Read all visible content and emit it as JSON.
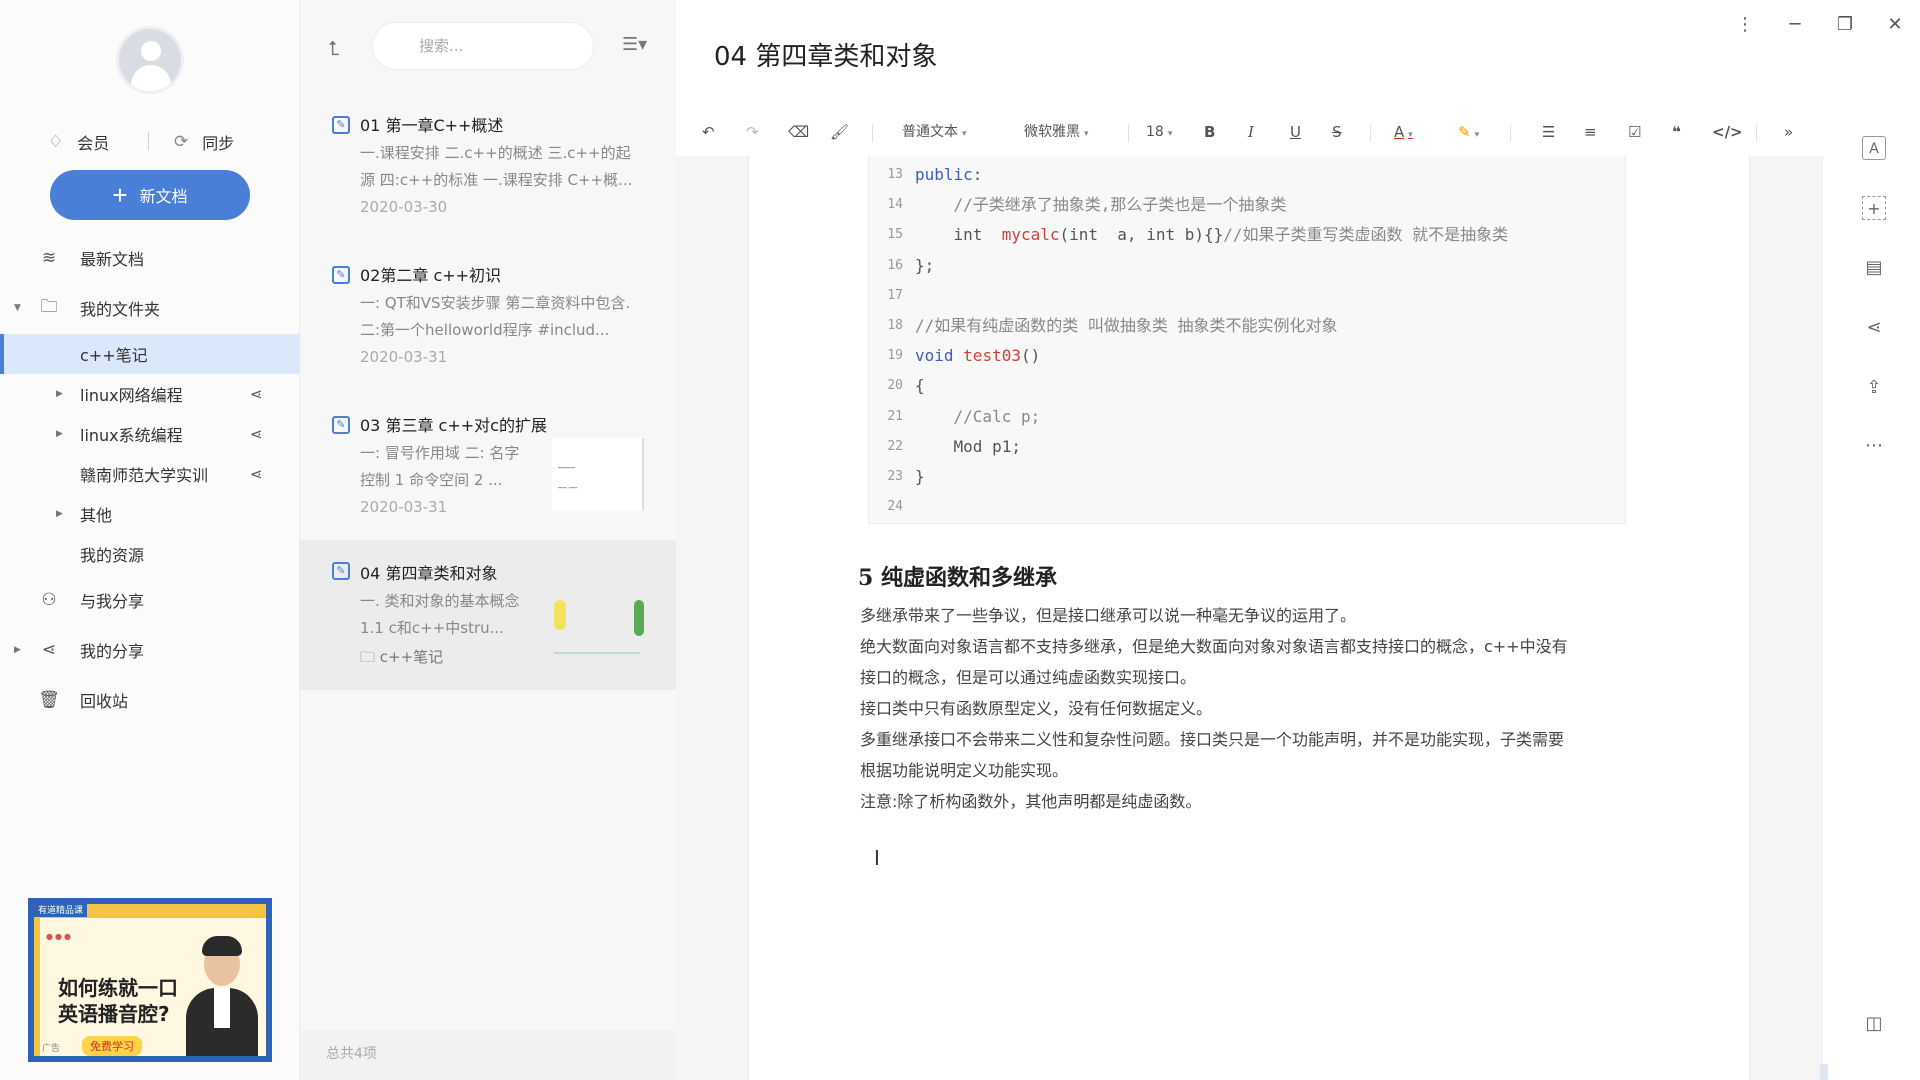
{
  "sidebar": {
    "member_label": "会员",
    "sync_label": "同步",
    "new_doc_label": "新文档",
    "nav": {
      "recent": "最新文档",
      "my_folder": "我的文件夹",
      "cpp_notes": "c++笔记",
      "linux_net": "linux网络编程",
      "linux_sys": "linux系统编程",
      "gnnu": "赣南师范大学实训",
      "other": "其他",
      "my_resources": "我的资源",
      "shared_with_me": "与我分享",
      "my_shares": "我的分享",
      "trash": "回收站"
    },
    "ad": {
      "tag": "有道精品课",
      "line1": "如何练就一口",
      "line2": "英语播音腔?",
      "cta": "免费学习",
      "corner": "广告"
    }
  },
  "list": {
    "search_placeholder": "搜索...",
    "notes": [
      {
        "title": "01 第一章C++概述",
        "summary": "一.课程安排 二.c++的概述 三.c++的起源 四:c++的标准 一.课程安排 C++概...",
        "date": "2020-03-30"
      },
      {
        "title": "02第二章 c++初识",
        "summary": "一: QT和VS安装步骤 第二章资料中包含. 二:第一个helloworld程序 #includ...",
        "date": "2020-03-31"
      },
      {
        "title": "03 第三章 c++对c的扩展",
        "summary": "一: 冒号作用域 二: 名字控制 1 命令空间 2 ...",
        "date": "2020-03-31"
      },
      {
        "title": "04 第四章类和对象",
        "summary": "一. 类和对象的基本概念 1.1 c和c++中stru...",
        "folder": "c++笔记"
      }
    ],
    "footer": "总共4项"
  },
  "editor": {
    "title": "04 第四章类和对象",
    "toolbar": {
      "paragraph_style": "普通文本",
      "font": "微软雅黑",
      "font_size": "18"
    },
    "code_lines": [
      {
        "n": "13",
        "html": "<span class=\"kw\">public</span>:"
      },
      {
        "n": "14",
        "html": "    <span class=\"cm\">//子类继承了抽象类,那么子类也是一个抽象类</span>"
      },
      {
        "n": "15",
        "html": "    int  <span class=\"fn\">mycalc</span>(int  a, int b){}<span class=\"cm\">//如果子类重写类虚函数 就不是抽象类</span>"
      },
      {
        "n": "16",
        "html": "};"
      },
      {
        "n": "17",
        "html": ""
      },
      {
        "n": "18",
        "html": "<span class=\"cm\">//如果有纯虚函数的类 叫做抽象类 抽象类不能实例化对象</span>"
      },
      {
        "n": "19",
        "html": "<span class=\"kw\">void</span> <span class=\"fn\">test03</span>()"
      },
      {
        "n": "20",
        "html": "{"
      },
      {
        "n": "21",
        "html": "    <span class=\"cm\">//Calc p;</span>"
      },
      {
        "n": "22",
        "html": "    Mod p1;"
      },
      {
        "n": "23",
        "html": "}"
      },
      {
        "n": "24",
        "html": ""
      }
    ],
    "heading": "5 纯虚函数和多继承",
    "paragraphs": [
      "多继承带来了一些争议，但是接口继承可以说一种毫无争议的运用了。",
      "绝大数面向对象语言都不支持多继承，但是绝大数面向对象对象语言都支持接口的概念，c++中没有",
      "接口的概念，但是可以通过纯虚函数实现接口。",
      "接口类中只有函数原型定义，没有任何数据定义。",
      "多重继承接口不会带来二义性和复杂性问题。接口类只是一个功能声明，并不是功能实现，子类需要",
      "根据功能说明定义功能实现。",
      "注意:除了析构函数外，其他声明都是纯虚函数。"
    ]
  }
}
